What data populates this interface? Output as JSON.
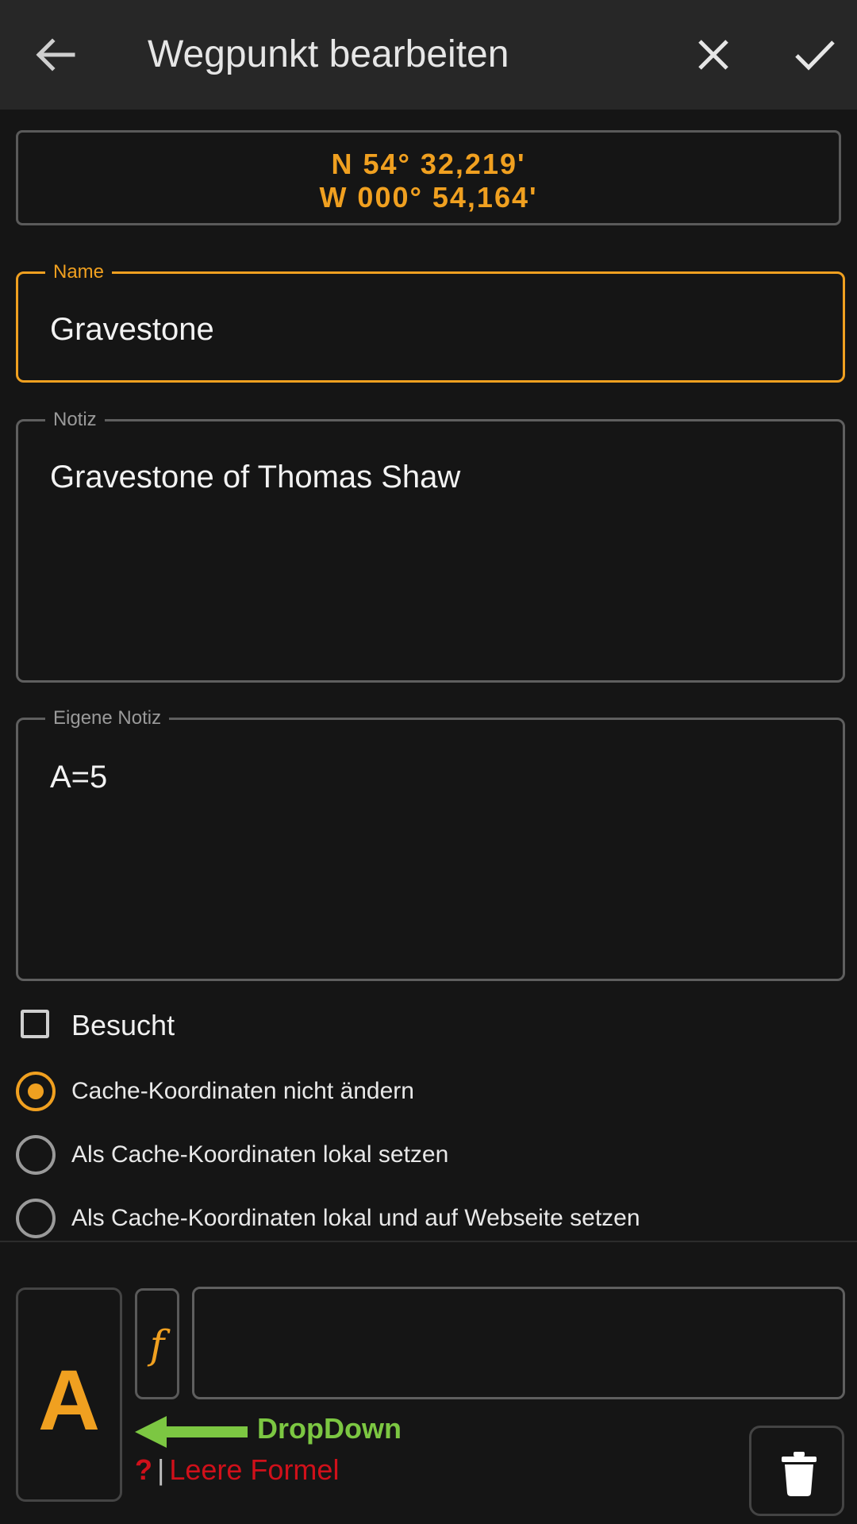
{
  "appbar": {
    "title": "Wegpunkt bearbeiten",
    "back_icon": "arrow-back-icon",
    "close_icon": "close-icon",
    "confirm_icon": "check-icon"
  },
  "coordinates": {
    "latitude": "N 54° 32,219'",
    "longitude": "W 000° 54,164'"
  },
  "fields": {
    "name": {
      "label": "Name",
      "value": "Gravestone"
    },
    "note": {
      "label": "Notiz",
      "value": "Gravestone of Thomas Shaw"
    },
    "own_note": {
      "label": "Eigene Notiz",
      "value": "A=5"
    }
  },
  "visited": {
    "label": "Besucht",
    "checked": false
  },
  "coordinate_options": {
    "selected_index": 0,
    "options": [
      {
        "label": "Cache-Koordinaten nicht ändern"
      },
      {
        "label": "Als Cache-Koordinaten lokal setzen"
      },
      {
        "label": "Als Cache-Koordinaten lokal und auf Webseite setzen"
      }
    ]
  },
  "formula": {
    "variable": "A",
    "function_symbol": "f",
    "input_value": "",
    "annotation": "DropDown",
    "status_symbol": "?",
    "status_separator": "|",
    "status_message": "Leere Formel",
    "delete_icon": "trash-icon"
  },
  "colors": {
    "accent": "#f0a020",
    "annotation_green": "#7cc742",
    "error_red": "#d0101a",
    "background": "#151515",
    "appbar": "#272727"
  }
}
